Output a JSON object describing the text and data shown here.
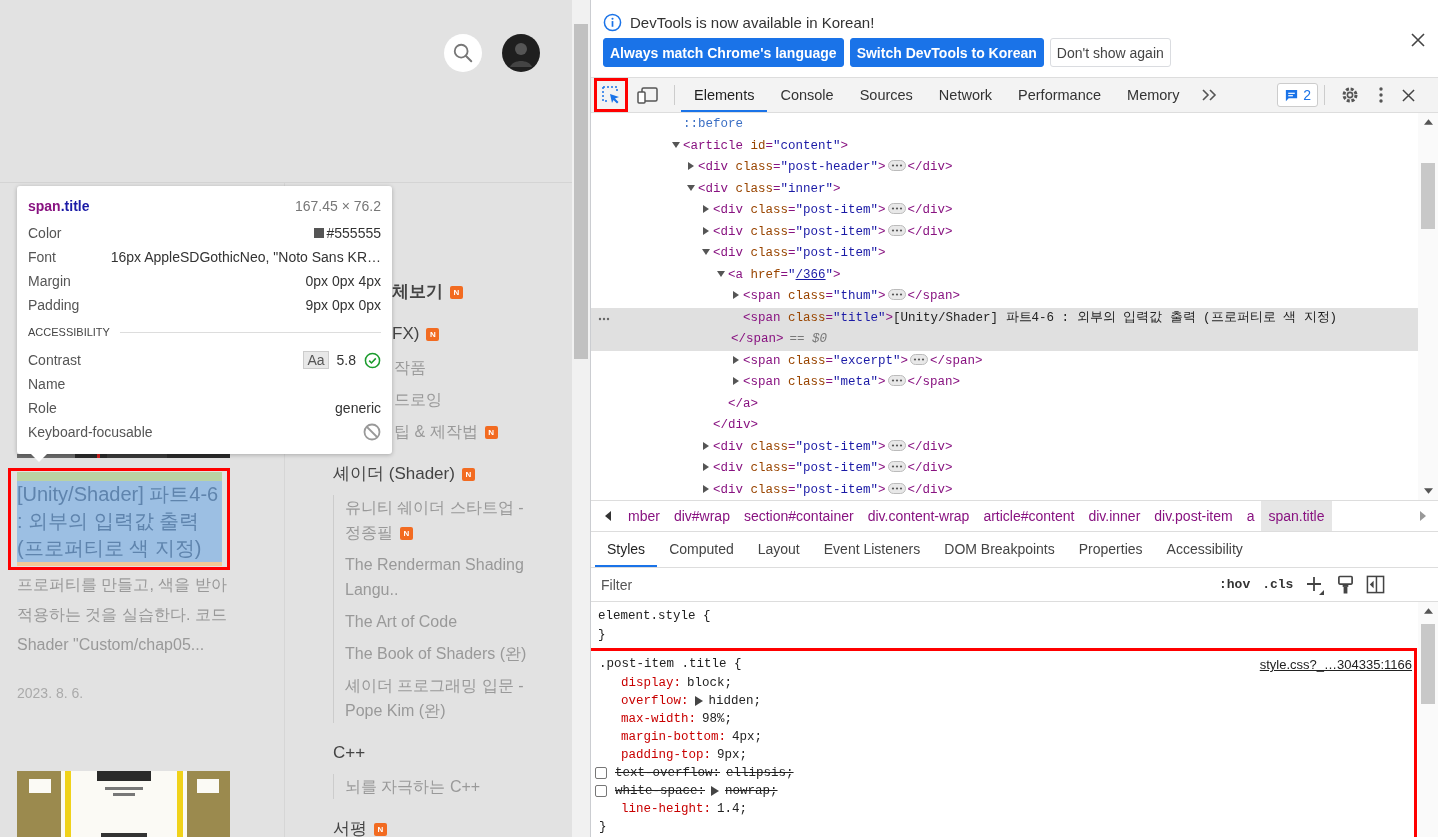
{
  "page": {
    "tooltip": {
      "tag": "span",
      "selector": ".title",
      "size": "167.45 × 76.2",
      "rows": [
        {
          "label": "Color",
          "kind": "color",
          "value": "#555555",
          "color": "#555555"
        },
        {
          "label": "Font",
          "kind": "text",
          "value": "16px AppleSDGothicNeo, \"Noto Sans KR…"
        },
        {
          "label": "Margin",
          "kind": "text",
          "value": "0px 0px 4px"
        },
        {
          "label": "Padding",
          "kind": "text",
          "value": "9px 0px 0px"
        }
      ],
      "section": "ACCESSIBILITY",
      "accessibility": [
        {
          "label": "Contrast",
          "kind": "contrast",
          "sample": "Aa",
          "value": "5.8",
          "passes": true
        },
        {
          "label": "Name",
          "kind": "text"
        },
        {
          "label": "Role",
          "kind": "text",
          "value": "generic"
        },
        {
          "label": "Keyboard-focusable",
          "kind": "focusable",
          "focusable": false
        }
      ]
    },
    "post": {
      "title": "[Unity/Shader] 파트4-6 : 외부의 입력값 출력 (프로퍼티로 색 지정)",
      "inspected": true,
      "annotated": true,
      "excerpt": "프로퍼티를 만들고, 색을 받아 적용하는 것을 실습한다. 코드 Shader \"Custom/chap05...",
      "date": "2023. 8. 6."
    },
    "categories": [
      {
        "label": "체보기",
        "bold": true,
        "covered": true,
        "badge": "N"
      },
      {
        "label": "FX)",
        "bold": false,
        "covered": true,
        "badge": "N",
        "children": [
          {
            "label": "작품",
            "covered": true
          },
          {
            "label": "드로잉",
            "covered": true
          },
          {
            "label": "팁 & 제작법",
            "covered": true,
            "badge": "N"
          }
        ]
      },
      {
        "label": "셰이더 (Shader)",
        "bold": false,
        "covered": false,
        "badge": "N",
        "children": [
          {
            "label": "유니티 쉐이더 스타트업 - 정종필",
            "covered": false,
            "badge": "N"
          },
          {
            "label": "The Renderman Shading Langu..",
            "covered": false
          },
          {
            "label": "The Art of Code",
            "covered": false
          },
          {
            "label": "The Book of Shaders (완)",
            "covered": false
          },
          {
            "label": "셰이더 프로그래밍 입문 - Pope Kim (완)",
            "covered": false
          }
        ]
      },
      {
        "label": "C++",
        "bold": false,
        "covered": false,
        "children": [
          {
            "label": "뇌를 자극하는 C++",
            "covered": false
          }
        ]
      },
      {
        "label": "서평",
        "bold": false,
        "covered": false,
        "badge": "N"
      }
    ]
  },
  "devtools": {
    "infobar": {
      "message": "DevTools is now available in Korean!",
      "buttons": [
        {
          "label": "Always match Chrome's language",
          "primary": true
        },
        {
          "label": "Switch DevTools to Korean",
          "primary": true
        },
        {
          "label": "Don't show again",
          "primary": false
        }
      ]
    },
    "toolbar": {
      "inspect": {
        "selected": true,
        "annotated": true
      },
      "tabs": [
        {
          "label": "Elements",
          "selected": true
        },
        {
          "label": "Console",
          "selected": false
        },
        {
          "label": "Sources",
          "selected": false
        },
        {
          "label": "Network",
          "selected": false
        },
        {
          "label": "Performance",
          "selected": false
        },
        {
          "label": "Memory",
          "selected": false
        }
      ],
      "issues": "2"
    },
    "dom_tree": [
      {
        "kind": "pseudo",
        "open": "::before",
        "selected": false
      },
      {
        "kind": "element",
        "open": "<article id=\"content\">",
        "expanded": true,
        "selected": false,
        "children": [
          {
            "kind": "element",
            "open": "<div class=\"post-header\">",
            "close": "</div>",
            "expanded": false,
            "selected": false
          },
          {
            "kind": "element",
            "open": "<div class=\"inner\">",
            "expanded": true,
            "selected": false,
            "children": [
              {
                "kind": "element",
                "open": "<div class=\"post-item\">",
                "close": "</div>",
                "expanded": false,
                "selected": false
              },
              {
                "kind": "element",
                "open": "<div class=\"post-item\">",
                "close": "</div>",
                "expanded": false,
                "selected": false
              },
              {
                "kind": "element",
                "open": "<div class=\"post-item\">",
                "close": "</div>",
                "expanded": true,
                "selected": false,
                "children": [
                  {
                    "kind": "element",
                    "open": "<a href=\"/366\">",
                    "close": "</a>",
                    "expanded": true,
                    "link": true,
                    "selected": false,
                    "children": [
                      {
                        "kind": "element",
                        "open": "<span class=\"thum\">",
                        "close": "</span>",
                        "expanded": false,
                        "selected": false
                      },
                      {
                        "kind": "element",
                        "open": "<span class=\"title\">",
                        "text": "[Unity/Shader] 파트4-6 : 외부의 입력값 출력 (프로퍼티로 색 지정)",
                        "close": "</span>",
                        "selected": true,
                        "console_ref": "== $0"
                      },
                      {
                        "kind": "element",
                        "open": "<span class=\"excerpt\">",
                        "close": "</span>",
                        "expanded": false,
                        "selected": false
                      },
                      {
                        "kind": "element",
                        "open": "<span class=\"meta\">",
                        "close": "</span>",
                        "expanded": false,
                        "selected": false
                      }
                    ]
                  }
                ]
              },
              {
                "kind": "element",
                "open": "<div class=\"post-item\">",
                "close": "</div>",
                "expanded": false,
                "selected": false
              },
              {
                "kind": "element",
                "open": "<div class=\"post-item\">",
                "close": "</div>",
                "expanded": false,
                "selected": false
              },
              {
                "kind": "element",
                "open": "<div class=\"post-item\">",
                "close": "</div>",
                "expanded": false,
                "selected": false
              }
            ]
          }
        ]
      }
    ],
    "breadcrumbs": [
      {
        "label": "mber",
        "selected": false
      },
      {
        "label": "div#wrap",
        "selected": false
      },
      {
        "label": "section#container",
        "selected": false
      },
      {
        "label": "div.content-wrap",
        "selected": false
      },
      {
        "label": "article#content",
        "selected": false
      },
      {
        "label": "div.inner",
        "selected": false
      },
      {
        "label": "div.post-item",
        "selected": false
      },
      {
        "label": "a",
        "selected": false
      },
      {
        "label": "span.title",
        "selected": true
      }
    ],
    "panel_tabs": [
      {
        "label": "Styles",
        "selected": true
      },
      {
        "label": "Computed",
        "selected": false
      },
      {
        "label": "Layout",
        "selected": false
      },
      {
        "label": "Event Listeners",
        "selected": false
      },
      {
        "label": "DOM Breakpoints",
        "selected": false
      },
      {
        "label": "Properties",
        "selected": false
      },
      {
        "label": "Accessibility",
        "selected": false
      }
    ],
    "filter": {
      "placeholder": "Filter"
    },
    "filter_tools": [
      ":hov",
      ".cls"
    ],
    "rules": [
      {
        "selector": "element.style {",
        "close": "}",
        "annotated": false
      },
      {
        "selector": ".post-item .title {",
        "source": "style.css?_…304335:1166",
        "close": "}",
        "annotated": true,
        "properties": [
          {
            "name": "display:",
            "value": "block;",
            "enabled": true,
            "expandable": false
          },
          {
            "name": "overflow:",
            "value": "hidden;",
            "enabled": true,
            "expandable": true
          },
          {
            "name": "max-width:",
            "value": "98%;",
            "enabled": true,
            "expandable": false
          },
          {
            "name": "margin-bottom:",
            "value": "4px;",
            "enabled": true,
            "expandable": false
          },
          {
            "name": "padding-top:",
            "value": "9px;",
            "enabled": true,
            "expandable": false
          },
          {
            "name": "text-overflow:",
            "value": "ellipsis;",
            "enabled": false,
            "expandable": false
          },
          {
            "name": "white-space:",
            "value": "nowrap;",
            "enabled": false,
            "expandable": true
          },
          {
            "name": "line-height:",
            "value": "1.4;",
            "enabled": true,
            "expandable": false
          }
        ]
      }
    ]
  }
}
